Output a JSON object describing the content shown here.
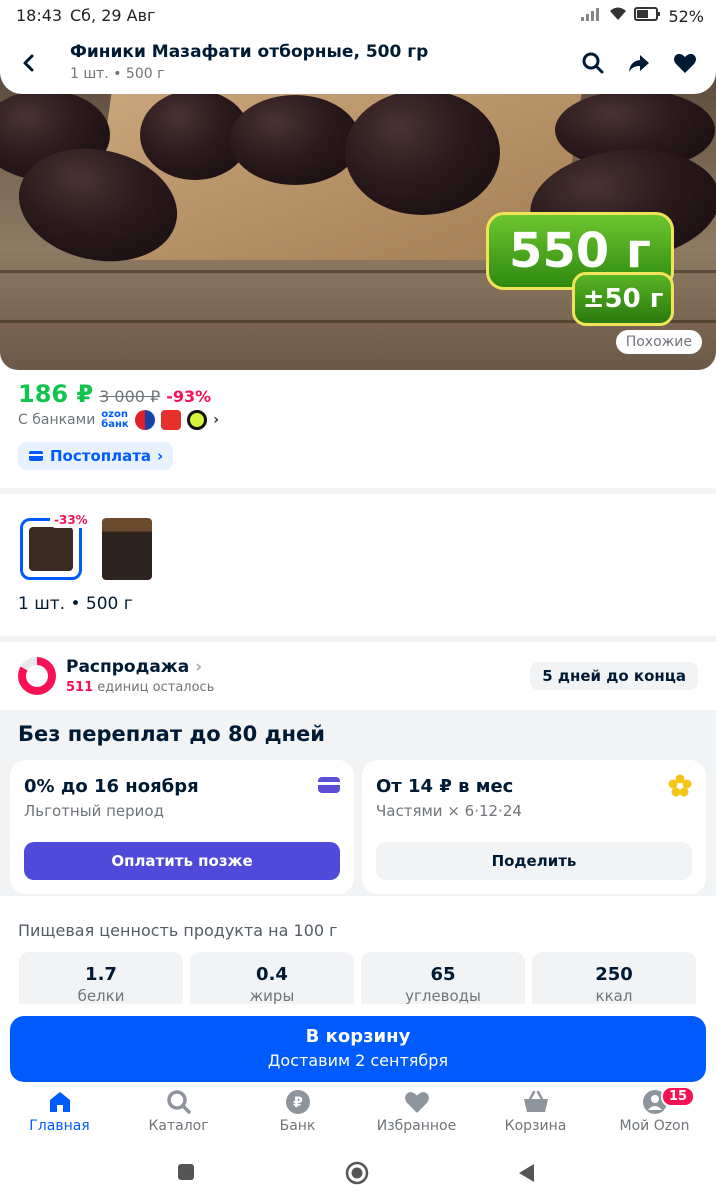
{
  "status_bar": {
    "time": "18:43",
    "date": "Сб, 29 Авг",
    "battery": "52%"
  },
  "header": {
    "title": "Финики Мазафати отборные, 500 гр",
    "subtitle": "1 шт. • 500 г"
  },
  "hero": {
    "badge_weight": "550 г",
    "badge_tolerance": "±50 г",
    "similar_label": "Похожие"
  },
  "price": {
    "current": "186 ₽",
    "old": "3 000 ₽",
    "discount": "-93%",
    "banks_label": "С банками",
    "ozon_bank": "ozon банк",
    "postpay_label": "Постоплата"
  },
  "variants": {
    "items": [
      {
        "discount": "-33%"
      },
      {
        "discount": ""
      }
    ],
    "selected_label": "1 шт. • 500 г"
  },
  "sale": {
    "title": "Распродажа",
    "remaining_count": "511",
    "remaining_text": "единиц осталось",
    "days_left": "5 дней до конца"
  },
  "installments": {
    "heading": "Без переплат до 80 дней",
    "cards": [
      {
        "title": "0% до 16 ноября",
        "subtitle": "Льготный период",
        "button": "Оплатить позже"
      },
      {
        "title": "От 14 ₽ в мес",
        "subtitle": "Частями × 6·12·24",
        "button": "Поделить"
      }
    ]
  },
  "nutrition": {
    "title": "Пищевая ценность продукта на 100 г",
    "items": [
      {
        "value": "1.7",
        "label": "белки"
      },
      {
        "value": "0.4",
        "label": "жиры"
      },
      {
        "value": "65",
        "label": "углеводы"
      },
      {
        "value": "250",
        "label": "ккал"
      }
    ]
  },
  "cart": {
    "label": "В корзину",
    "delivery": "Доставим 2 сентября"
  },
  "bottom_nav": {
    "items": [
      {
        "label": "Главная",
        "icon": "home-icon"
      },
      {
        "label": "Каталог",
        "icon": "search-icon"
      },
      {
        "label": "Банк",
        "icon": "ruble-icon"
      },
      {
        "label": "Избранное",
        "icon": "heart-icon"
      },
      {
        "label": "Корзина",
        "icon": "basket-icon"
      },
      {
        "label": "Мой Ozon",
        "icon": "profile-icon"
      }
    ],
    "profile_badge": "15"
  },
  "colors": {
    "accent": "#005bff",
    "price_green": "#10c44c",
    "discount_pink": "#f91155",
    "pay_later": "#4f4ad9"
  }
}
